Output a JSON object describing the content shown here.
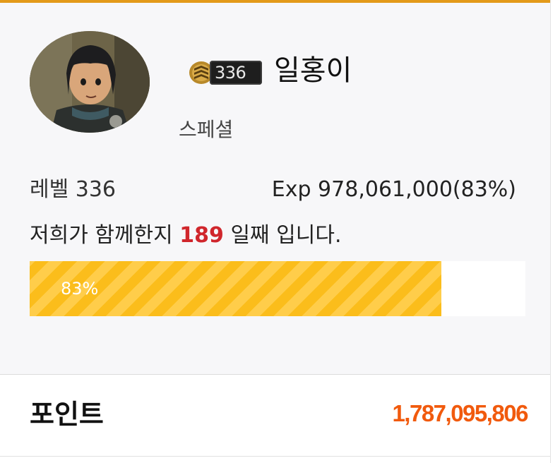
{
  "profile": {
    "username": "일홍이",
    "level_badge_number": "336",
    "grade": "스페셜",
    "level_text": "레벨 336",
    "exp_text": "Exp 978,061,000(83%)",
    "days_prefix": "저희가 함께한지 ",
    "days_count": "189",
    "days_suffix": " 일째 입니다.",
    "progress_label": "83%",
    "progress_fraction": 0.83
  },
  "points": {
    "label": "포인트",
    "value": "1,787,095,806"
  },
  "colors": {
    "accent_top": "#e39a1a",
    "progress_fill": "#fbbd1b",
    "days_highlight": "#d0262c",
    "points_value": "#f15a0d"
  },
  "icons": {
    "level_badge_icon": "rank-chevron-icon",
    "avatar": "user-avatar"
  }
}
